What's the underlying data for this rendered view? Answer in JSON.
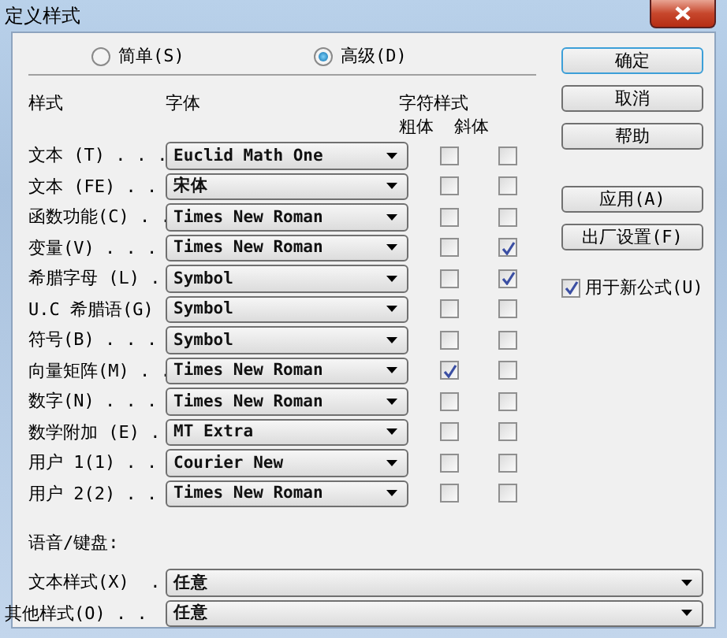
{
  "window": {
    "title": "定义样式"
  },
  "mode_options": [
    {
      "label": "简单(S)",
      "selected": false
    },
    {
      "label": "高级(D)",
      "selected": true
    }
  ],
  "headers": {
    "style": "样式",
    "font": "字体",
    "char_style": "字符样式",
    "bold": "粗体",
    "italic": "斜体"
  },
  "styles": [
    {
      "label": "文本 (T) . . .",
      "font": "Euclid Math One",
      "bold": false,
      "italic": false
    },
    {
      "label": "文本 (FE) . .",
      "font": "宋体",
      "bold": false,
      "italic": false
    },
    {
      "label": "函数功能(C) . .",
      "font": "Times New Roman",
      "bold": false,
      "italic": false
    },
    {
      "label": "变量(V) . . .",
      "font": "Times New Roman",
      "bold": false,
      "italic": true
    },
    {
      "label": "希腊字母 (L) .",
      "font": "Symbol",
      "bold": false,
      "italic": true
    },
    {
      "label": "U.C 希腊语(G)",
      "font": "Symbol",
      "bold": false,
      "italic": false
    },
    {
      "label": "符号(B) . . .",
      "font": "Symbol",
      "bold": false,
      "italic": false
    },
    {
      "label": "向量矩阵(M) . .",
      "font": "Times New Roman",
      "bold": true,
      "italic": false
    },
    {
      "label": "数字(N) . . .",
      "font": "Times New Roman",
      "bold": false,
      "italic": false
    },
    {
      "label": "数学附加 (E) .",
      "font": "MT Extra",
      "bold": false,
      "italic": false
    },
    {
      "label": "用户 1(1) . .",
      "font": "Courier New",
      "bold": false,
      "italic": false
    },
    {
      "label": "用户 2(2) . .",
      "font": "Times New Roman",
      "bold": false,
      "italic": false
    }
  ],
  "language": {
    "title": "语音/键盘:",
    "rows": [
      {
        "label": "文本样式(X)  .",
        "value": "任意"
      },
      {
        "label": "其他样式(O) . .",
        "value": "任意"
      }
    ]
  },
  "buttons": [
    {
      "label": "确定",
      "default": true
    },
    {
      "label": "取消",
      "default": false
    },
    {
      "label": "帮助",
      "default": false
    }
  ],
  "apply_buttons": [
    {
      "label": "应用(A)"
    },
    {
      "label": "出厂设置(F)"
    }
  ],
  "use_for_new": {
    "label": "用于新公式(U)",
    "checked": true
  }
}
